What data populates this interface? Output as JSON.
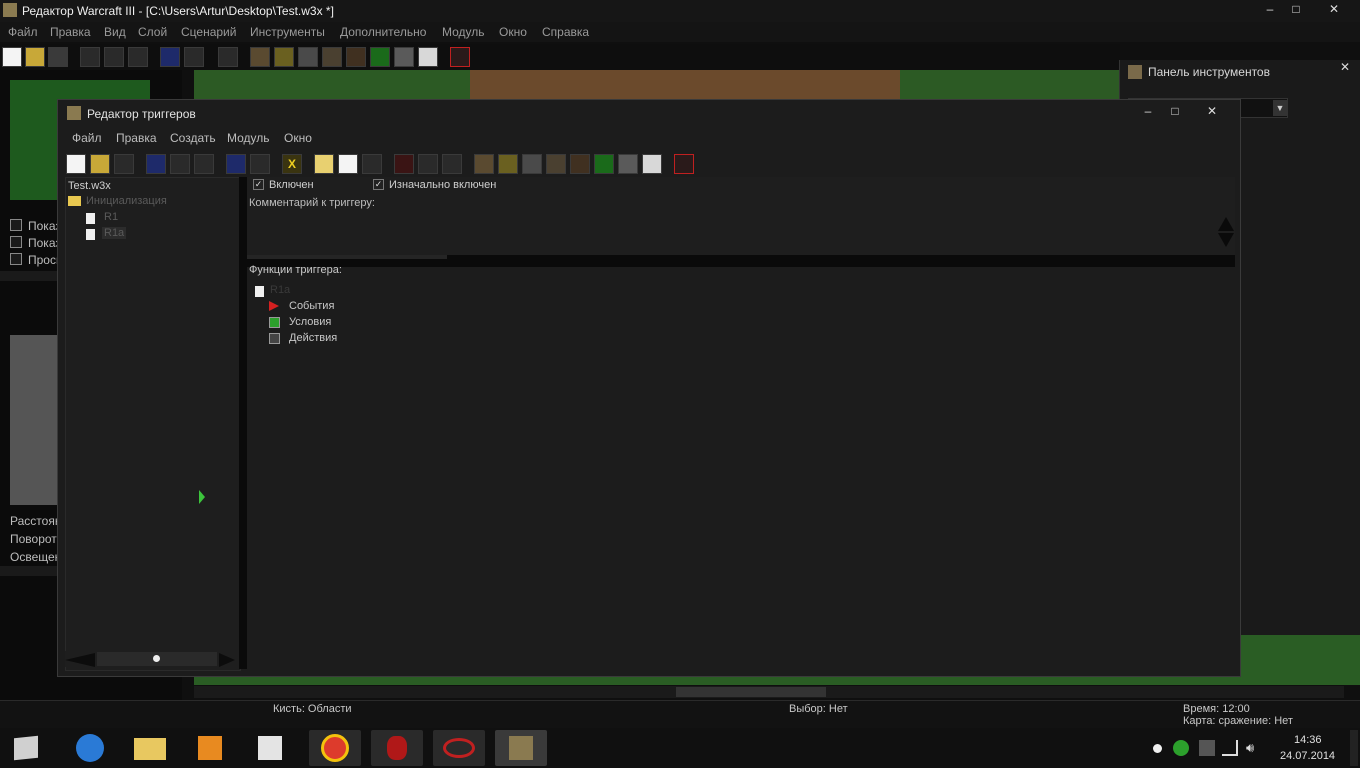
{
  "main_window": {
    "title": "Редактор Warcraft III  - [C:\\Users\\Artur\\Desktop\\Test.w3x *]",
    "minimize": "–",
    "maximize": "□",
    "close": "✕"
  },
  "main_menu": [
    "Файл",
    "Правка",
    "Вид",
    "Слой",
    "Сценарий",
    "Инструменты",
    "Дополнительно",
    "Модуль",
    "Окно",
    "Справка"
  ],
  "left_panel": {
    "checks": [
      "Показ",
      "Показ",
      "Просм"
    ],
    "labels": [
      "Расстоян",
      "Поворот:",
      "Освещен"
    ]
  },
  "tools_panel": {
    "title": "Панель инструментов",
    "close": "✕"
  },
  "trigger_editor": {
    "title": "Редактор триггеров",
    "minimize": "–",
    "maximize": "□",
    "close": "✕",
    "menu": [
      "Файл",
      "Правка",
      "Создать",
      "Модуль",
      "Окно"
    ],
    "tree": {
      "root": "Test.w3x",
      "category": "Инициализация",
      "items": [
        "R1",
        "R1a"
      ]
    },
    "enabled_label": "Включен",
    "initially_enabled_label": "Изначально включен",
    "comment_label": "Комментарий к триггеру:",
    "functions_label": "Функции триггера:",
    "function_tree": {
      "trigger_name": "R1a",
      "nodes": [
        "События",
        "Условия",
        "Действия"
      ]
    }
  },
  "status_bar": {
    "brush": "Кисть: Области",
    "selection": "Выбор: Нет",
    "time": "Время: 12:00",
    "map": "Карта: сражение: Нет"
  },
  "taskbar": {
    "clock_time": "14:36",
    "clock_date": "24.07.2014",
    "apps": [
      "windows-logo",
      "internet-explorer",
      "file-explorer",
      "media-player",
      "paint",
      "chrome",
      "game-red",
      "game-eye",
      "warcraft-editor"
    ]
  },
  "colors": {
    "accent_red": "#d42020",
    "accent_green": "#2ca02c",
    "map_grass": "#2c5a24"
  }
}
